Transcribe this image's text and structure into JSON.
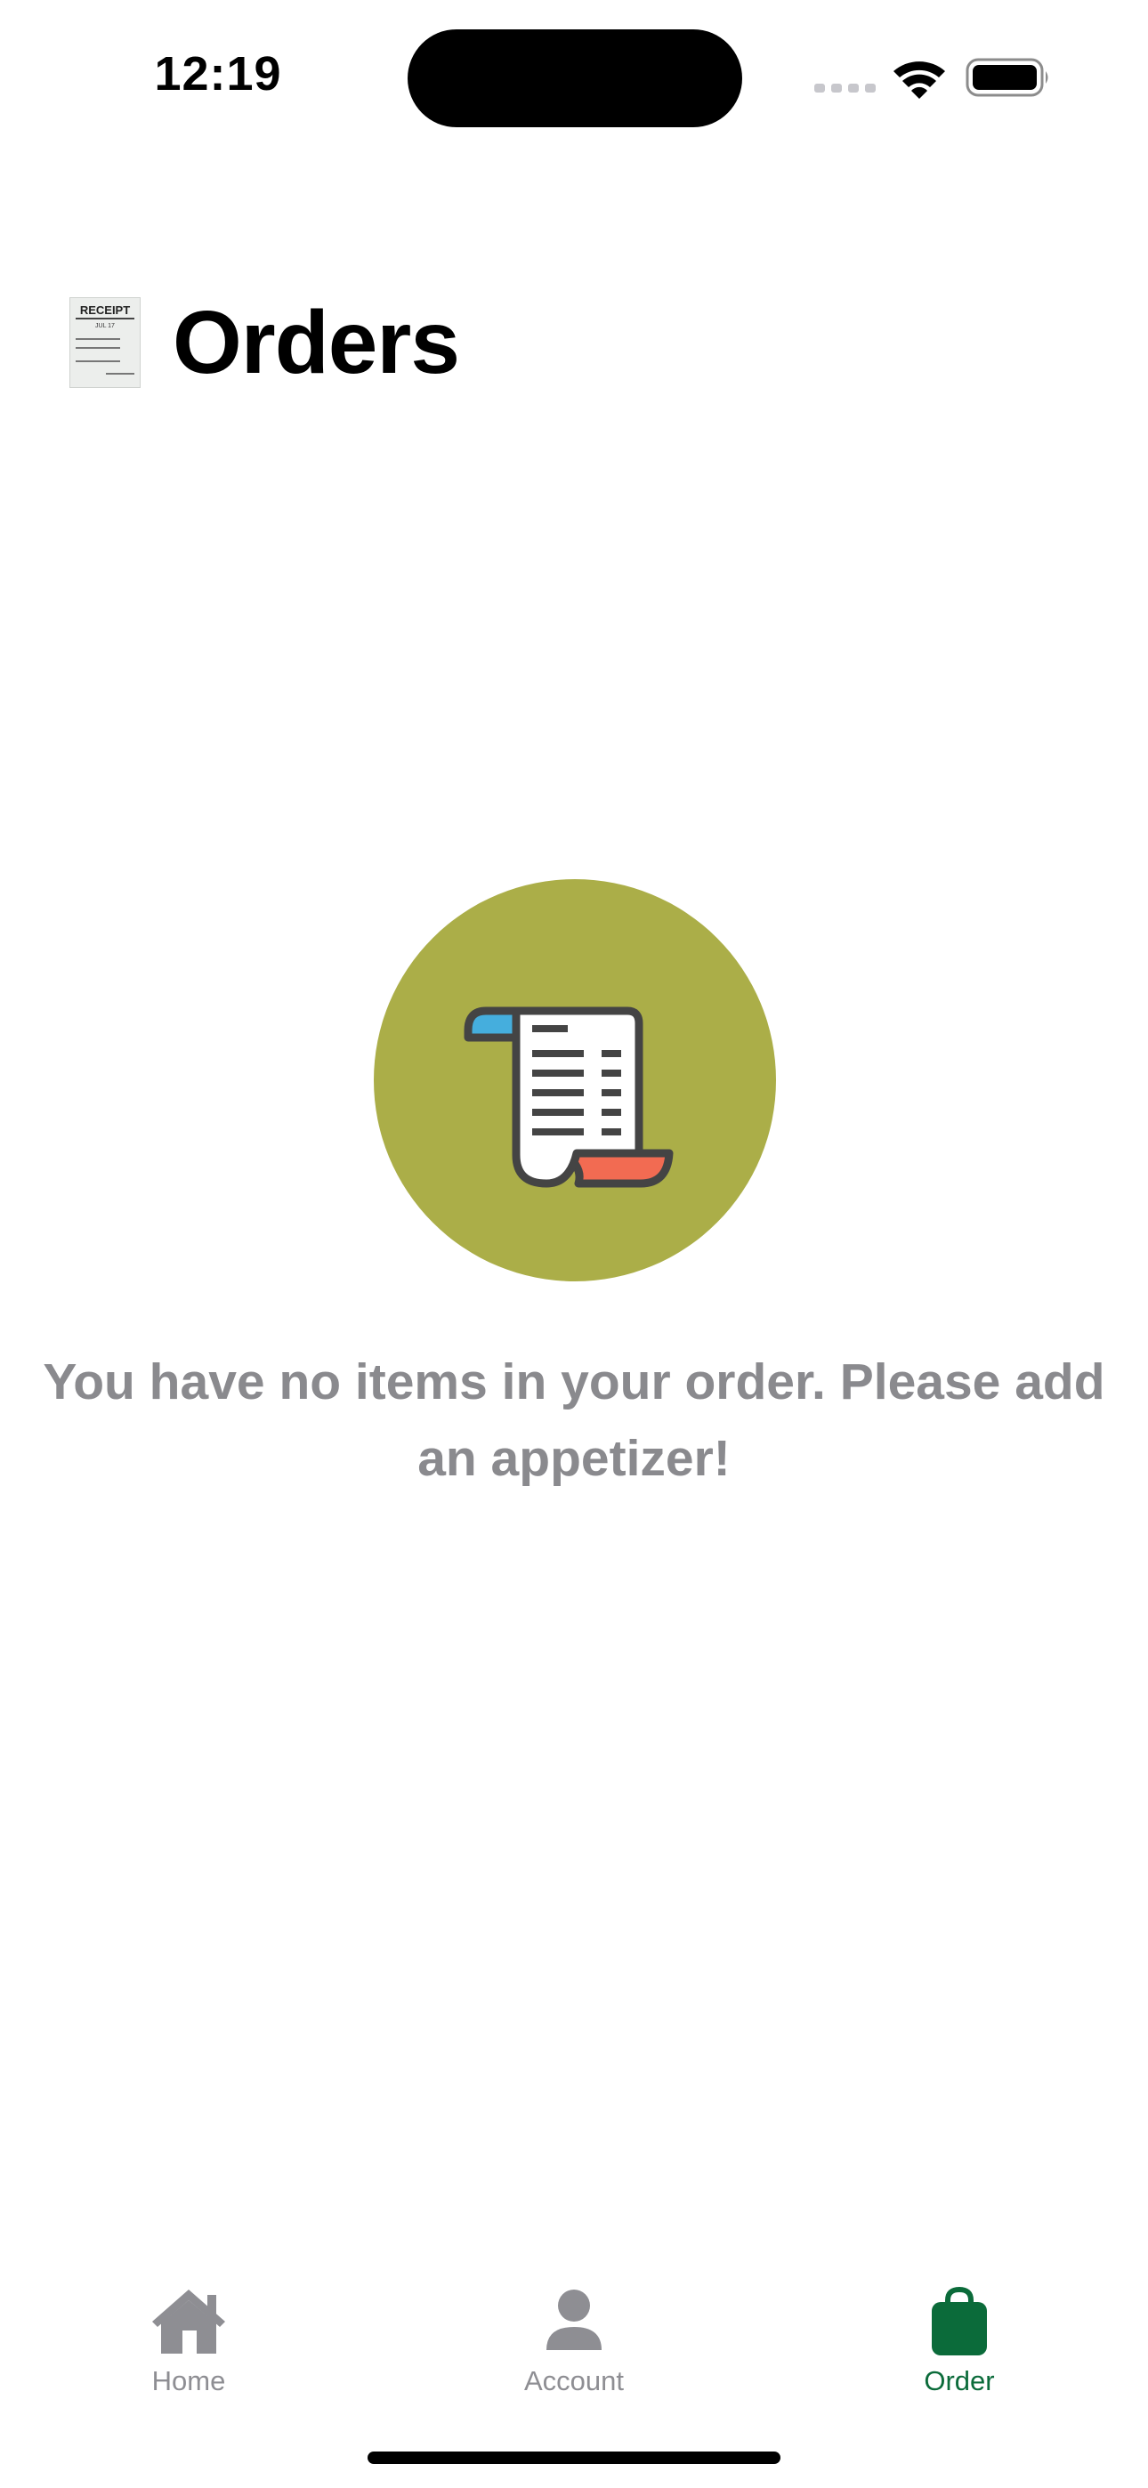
{
  "status_bar": {
    "time": "12:19"
  },
  "header": {
    "title": "Orders",
    "title_icon": "receipt-emoji",
    "receipt_icon_text": {
      "heading": "RECEIPT",
      "date": "JUL 17"
    }
  },
  "empty_state": {
    "icon": "receipt-scroll-icon",
    "circle_color": "#abae48",
    "message": "You have no items in your order. Please add an appetizer!"
  },
  "tab_bar": {
    "active_color": "#0b6b3a",
    "inactive_color": "#8e8e93",
    "tabs": [
      {
        "label": "Home",
        "icon": "house-icon",
        "active": false
      },
      {
        "label": "Account",
        "icon": "person-icon",
        "active": false
      },
      {
        "label": "Order",
        "icon": "bag-icon",
        "active": true
      }
    ]
  }
}
